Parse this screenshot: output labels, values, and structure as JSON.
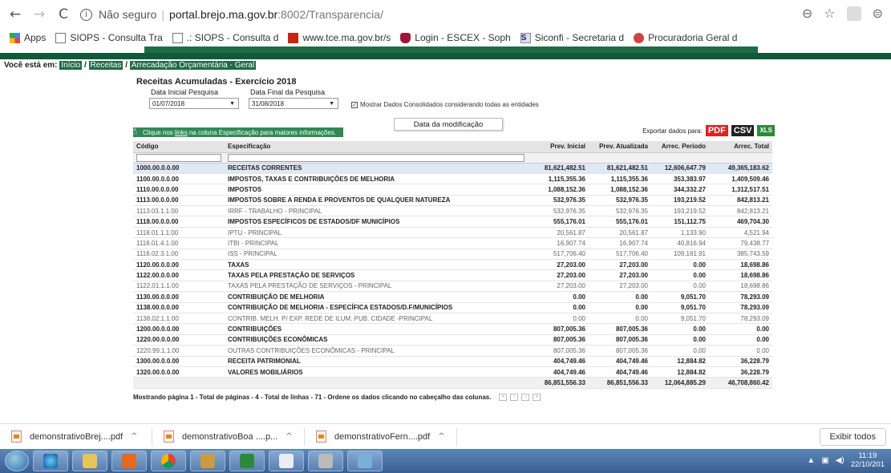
{
  "browser": {
    "not_secure": "Não seguro",
    "domain": "portal.brejo.ma.gov.br",
    "path": ":8002/Transparencia/"
  },
  "bookmarks": [
    {
      "label": "Apps",
      "icon": "apps-grid-icon",
      "muted": ""
    },
    {
      "label": "SIOPS - Consulta Tra",
      "icon": "page-icon",
      "muted": ""
    },
    {
      "label": ".: SIOPS - Consulta d",
      "icon": "page-icon",
      "muted": ""
    },
    {
      "label": "www.tce.ma.gov.br/s",
      "icon": "tce-icon",
      "muted": ""
    },
    {
      "label": "Login - ESCEX - Soph",
      "icon": "escex-icon",
      "muted": ""
    },
    {
      "label": "Siconfi - Secretaria d",
      "icon": "siconfi-icon",
      "muted": ""
    },
    {
      "label": "Procuradoria Geral d",
      "icon": "procuradoria-icon",
      "muted": ""
    }
  ],
  "breadcrumb": {
    "prefix": "Você está em:",
    "items": [
      "Início",
      "Receitas",
      "Arrecadação Orçamentária - Geral"
    ]
  },
  "page": {
    "title": "Receitas Acumuladas - Exercício 2018",
    "start_label": "Data Inicial Pesquisa",
    "start_value": "01/07/2018",
    "end_label": "Data Final da Pesquisa",
    "end_value": "31/08/2018",
    "checkbox_label": "Mostrar Dados Consolidados considerando todas as entidades",
    "tooltip": "Data da modificação",
    "hint_prefix": "Clique nos",
    "hint_link": "links",
    "hint_suffix": "na coluna Especificação para maiores informações.",
    "export_label": "Exportar dados para:",
    "export_pdf": "PDF",
    "export_csv": "CSV",
    "export_xls": "XLS"
  },
  "table": {
    "headers": {
      "codigo": "Código",
      "especificacao": "Especificação",
      "prev_inicial": "Prev. Inicial",
      "prev_atualizada": "Prev. Atualizada",
      "arrec_periodo": "Arrec. Período",
      "arrec_total": "Arrec. Total"
    },
    "rows": [
      {
        "codigo": "1000.00.0.0.00",
        "esp": "RECEITAS CORRENTES",
        "pi": "81,621,482.51",
        "pa": "81,621,482.51",
        "ap": "12,606,647.79",
        "at": "49,365,183.62",
        "style": "bold hl"
      },
      {
        "codigo": "1100.00.0.0.00",
        "esp": "IMPOSTOS, TAXAS E CONTRIBUIÇÕES DE MELHORIA",
        "pi": "1,115,355.36",
        "pa": "1,115,355.36",
        "ap": "353,383.97",
        "at": "1,409,509.46",
        "style": "bold"
      },
      {
        "codigo": "1110.00.0.0.00",
        "esp": "IMPOSTOS",
        "pi": "1,088,152.36",
        "pa": "1,088,152.36",
        "ap": "344,332.27",
        "at": "1,312,517.51",
        "style": "bold"
      },
      {
        "codigo": "1113.00.0.0.00",
        "esp": "IMPOSTOS SOBRE A RENDA E PROVENTOS DE QUALQUER NATUREZA",
        "pi": "532,976.35",
        "pa": "532,976.35",
        "ap": "193,219.52",
        "at": "842,813.21",
        "style": "bold"
      },
      {
        "codigo": "1113.03.1.1.00",
        "esp": "IRRF - TRABALHO - PRINCIPAL",
        "pi": "532,976.35",
        "pa": "532,976.35",
        "ap": "193,219.52",
        "at": "842,813.21",
        "style": "light"
      },
      {
        "codigo": "1118.00.0.0.00",
        "esp": "IMPOSTOS ESPECÍFICOS DE ESTADOS/DF MUNICÍPIOS",
        "pi": "555,176.01",
        "pa": "555,176.01",
        "ap": "151,112.75",
        "at": "469,704.30",
        "style": "bold"
      },
      {
        "codigo": "1118.01.1.1.00",
        "esp": "IPTU - PRINCIPAL",
        "pi": "20,561.87",
        "pa": "20,561.87",
        "ap": "1,133.90",
        "at": "4,521.94",
        "style": "light"
      },
      {
        "codigo": "1118.01.4.1.00",
        "esp": "ITBI - PRINCIPAL",
        "pi": "16,907.74",
        "pa": "16,907.74",
        "ap": "40,816.94",
        "at": "79,438.77",
        "style": "light"
      },
      {
        "codigo": "1118.02.3.1.00",
        "esp": "ISS - PRINCIPAL",
        "pi": "517,706.40",
        "pa": "517,706.40",
        "ap": "109,161.91",
        "at": "385,743.59",
        "style": "light"
      },
      {
        "codigo": "1120.00.0.0.00",
        "esp": "TAXAS",
        "pi": "27,203.00",
        "pa": "27,203.00",
        "ap": "0.00",
        "at": "18,698.86",
        "style": "bold"
      },
      {
        "codigo": "1122.00.0.0.00",
        "esp": "TAXAS PELA PRESTAÇÃO DE SERVIÇOS",
        "pi": "27,203.00",
        "pa": "27,203.00",
        "ap": "0.00",
        "at": "18,698.86",
        "style": "bold"
      },
      {
        "codigo": "1122.01.1.1.00",
        "esp": "TAXAS PELA PRESTAÇÃO DE SERVIÇOS - PRINCIPAL",
        "pi": "27,203.00",
        "pa": "27,203.00",
        "ap": "0.00",
        "at": "18,698.86",
        "style": "light"
      },
      {
        "codigo": "1130.00.0.0.00",
        "esp": "CONTRIBUIÇÃO DE MELHORIA",
        "pi": "0.00",
        "pa": "0.00",
        "ap": "9,051.70",
        "at": "78,293.09",
        "style": "bold"
      },
      {
        "codigo": "1138.00.0.0.00",
        "esp": "CONTRIBUIÇÃO DE MELHORIA - ESPECÍFICA ESTADOS/D.F/MUNICÍPIOS",
        "pi": "0.00",
        "pa": "0.00",
        "ap": "9,051.70",
        "at": "78,293.09",
        "style": "bold"
      },
      {
        "codigo": "1138.02.1.1.00",
        "esp": "CONTRIB. MELH. P/ EXP. REDE DE ILUM. PUB. CIDADE -PRINCIPAL",
        "pi": "0.00",
        "pa": "0.00",
        "ap": "9,051.70",
        "at": "78,293.09",
        "style": "light"
      },
      {
        "codigo": "1200.00.0.0.00",
        "esp": "CONTRIBUIÇÕES",
        "pi": "807,005.36",
        "pa": "807,005.36",
        "ap": "0.00",
        "at": "0.00",
        "style": "bold"
      },
      {
        "codigo": "1220.00.0.0.00",
        "esp": "CONTRIBUIÇÕES ECONÔMICAS",
        "pi": "807,005.36",
        "pa": "807,005.36",
        "ap": "0.00",
        "at": "0.00",
        "style": "bold"
      },
      {
        "codigo": "1220.99.1.1.00",
        "esp": "OUTRAS CONTRIBUIÇÕES ECONÔMICAS - PRINCIPAL",
        "pi": "807,005.36",
        "pa": "807,005.36",
        "ap": "0.00",
        "at": "0.00",
        "style": "light"
      },
      {
        "codigo": "1300.00.0.0.00",
        "esp": "RECEITA PATRIMONIAL",
        "pi": "404,749.46",
        "pa": "404,749.46",
        "ap": "12,884.82",
        "at": "36,228.79",
        "style": "bold"
      },
      {
        "codigo": "1320.00.0.0.00",
        "esp": "VALORES MOBILIÁRIOS",
        "pi": "404,749.46",
        "pa": "404,749.46",
        "ap": "12,884.82",
        "at": "36,228.79",
        "style": "bold"
      }
    ],
    "totals": {
      "pi": "86,851,556.33",
      "pa": "86,851,556.33",
      "ap": "12,064,885.29",
      "at": "46,708,860.42"
    }
  },
  "pager": {
    "text": "Mostrando página 1 - Total de páginas - 4 - Total de linhas - 71 - Ordene os dados clicando no cabeçalho das colunas."
  },
  "downloads": [
    {
      "name": "demonstrativoBrej....pdf"
    },
    {
      "name": "demonstrativoBoa ....p..."
    },
    {
      "name": "demonstrativoFern....pdf"
    }
  ],
  "downloads_show_all": "Exibir todos",
  "clock": {
    "time": "11:19",
    "date": "22/10/201"
  }
}
